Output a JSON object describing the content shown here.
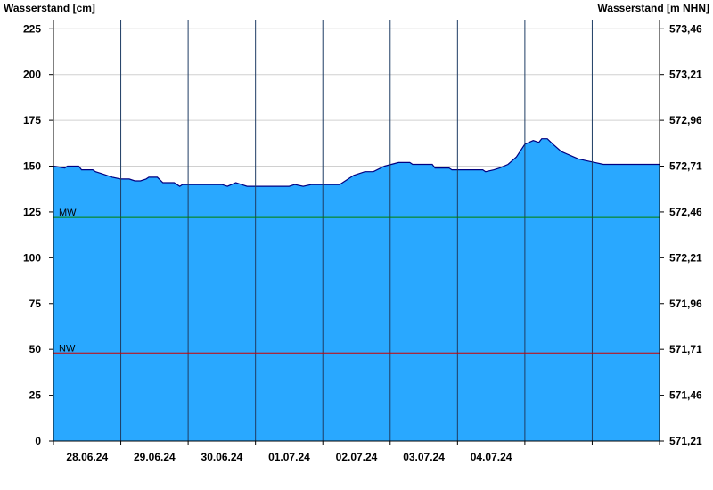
{
  "chart_data": {
    "type": "area",
    "title": "",
    "ylabel_left": "Wasserstand [cm]",
    "ylabel_right": "Wasserstand [m NHN]",
    "ylim": [
      0,
      230
    ],
    "y_ticks_left": [
      0,
      25,
      50,
      75,
      100,
      125,
      150,
      175,
      200,
      225
    ],
    "y_ticks_right": [
      "571,21",
      "571,46",
      "571,71",
      "571,96",
      "572,21",
      "572,46",
      "572,71",
      "572,96",
      "573,21",
      "573,46"
    ],
    "x_start": "27.06.24",
    "x_days": [
      "28.06.24",
      "29.06.24",
      "30.06.24",
      "01.07.24",
      "02.07.24",
      "03.07.24",
      "04.07.24"
    ],
    "x_end": "05.07.24",
    "reference_lines": [
      {
        "label": "MW",
        "value": 122,
        "color": "#008000"
      },
      {
        "label": "NW",
        "value": 48,
        "color": "#cc0000"
      }
    ],
    "series": [
      {
        "name": "",
        "color": "#29a8ff",
        "edge_color": "#000080",
        "points": [
          [
            "27.06.24 00:00",
            150
          ],
          [
            "27.06.24 04:00",
            149
          ],
          [
            "27.06.24 05:00",
            150
          ],
          [
            "27.06.24 09:00",
            150
          ],
          [
            "27.06.24 10:00",
            148
          ],
          [
            "27.06.24 14:00",
            148
          ],
          [
            "27.06.24 15:00",
            147
          ],
          [
            "27.06.24 17:00",
            146
          ],
          [
            "27.06.24 19:00",
            145
          ],
          [
            "27.06.24 21:00",
            144
          ],
          [
            "28.06.24 00:00",
            143
          ],
          [
            "28.06.24 03:00",
            143
          ],
          [
            "28.06.24 05:00",
            142
          ],
          [
            "28.06.24 07:00",
            142
          ],
          [
            "28.06.24 09:00",
            143
          ],
          [
            "28.06.24 10:00",
            144
          ],
          [
            "28.06.24 13:00",
            144
          ],
          [
            "28.06.24 15:00",
            141
          ],
          [
            "28.06.24 19:00",
            141
          ],
          [
            "28.06.24 21:00",
            139
          ],
          [
            "28.06.24 22:00",
            140
          ],
          [
            "29.06.24 12:00",
            140
          ],
          [
            "29.06.24 14:00",
            139
          ],
          [
            "29.06.24 17:00",
            141
          ],
          [
            "29.06.24 19:00",
            140
          ],
          [
            "29.06.24 21:00",
            139
          ],
          [
            "30.06.24 00:00",
            139
          ],
          [
            "30.06.24 12:00",
            139
          ],
          [
            "30.06.24 14:00",
            140
          ],
          [
            "30.06.24 17:00",
            139
          ],
          [
            "30.06.24 20:00",
            140
          ],
          [
            "01.07.24 06:00",
            140
          ],
          [
            "01.07.24 08:00",
            142
          ],
          [
            "01.07.24 11:00",
            145
          ],
          [
            "01.07.24 15:00",
            147
          ],
          [
            "01.07.24 18:00",
            147
          ],
          [
            "01.07.24 22:00",
            150
          ],
          [
            "02.07.24 03:00",
            152
          ],
          [
            "02.07.24 07:00",
            152
          ],
          [
            "02.07.24 08:00",
            151
          ],
          [
            "02.07.24 15:00",
            151
          ],
          [
            "02.07.24 16:00",
            149
          ],
          [
            "02.07.24 21:00",
            149
          ],
          [
            "02.07.24 22:00",
            148
          ],
          [
            "03.07.24 09:00",
            148
          ],
          [
            "03.07.24 10:00",
            147
          ],
          [
            "03.07.24 13:00",
            148
          ],
          [
            "03.07.24 15:00",
            149
          ],
          [
            "03.07.24 18:00",
            151
          ],
          [
            "03.07.24 21:00",
            155
          ],
          [
            "04.07.24 00:00",
            162
          ],
          [
            "04.07.24 03:00",
            164
          ],
          [
            "04.07.24 05:00",
            163
          ],
          [
            "04.07.24 06:00",
            165
          ],
          [
            "04.07.24 08:00",
            165
          ],
          [
            "04.07.24 10:00",
            162
          ],
          [
            "04.07.24 13:00",
            158
          ],
          [
            "04.07.24 16:00",
            156
          ],
          [
            "04.07.24 19:00",
            154
          ],
          [
            "04.07.24 22:00",
            153
          ],
          [
            "05.07.24 01:00",
            152
          ],
          [
            "05.07.24 04:00",
            151
          ],
          [
            "05.07.24 09:00",
            151
          ],
          [
            "05.07.24 24:00",
            151
          ]
        ]
      }
    ],
    "grid": {
      "horizontal": true,
      "vertical_day_lines": true
    }
  }
}
